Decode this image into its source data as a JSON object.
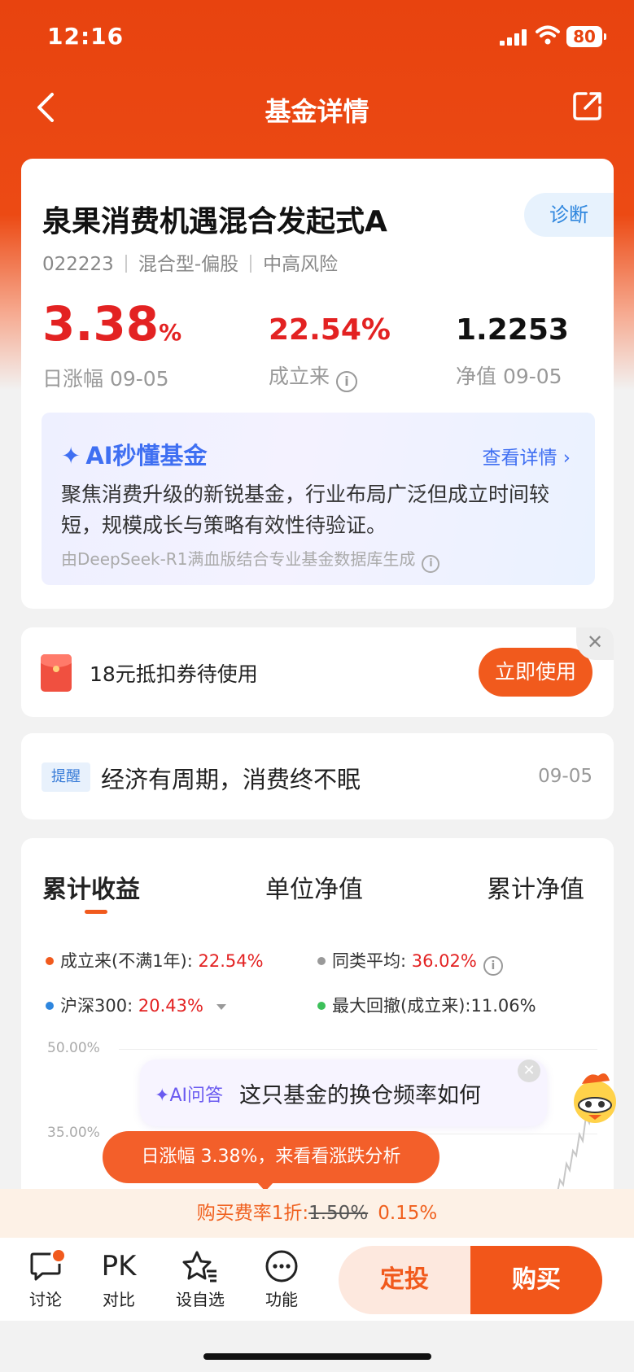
{
  "status": {
    "time": "12:16",
    "battery": "80"
  },
  "nav": {
    "title": "基金详情",
    "back_icon": "chevron-left-icon",
    "share_icon": "share-icon"
  },
  "fund": {
    "name": "泉果消费机遇混合发起式A",
    "diagnose_label": "诊断",
    "code": "022223",
    "type": "混合型-偏股",
    "risk": "中高风险",
    "daily_change": "3.38",
    "daily_change_unit": "%",
    "daily_change_label": "日涨幅 09-05",
    "since_inception": "22.54%",
    "since_inception_label": "成立来",
    "nav_value": "1.2253",
    "nav_label": "净值 09-05"
  },
  "ai_card": {
    "title": "AI秒懂基金",
    "more": "查看详情",
    "text": "聚焦消费升级的新锐基金，行业布局广泛但成立时间较短，规模成长与策略有效性待验证。",
    "source": "由DeepSeek-R1满血版结合专业基金数据库生成"
  },
  "coupon": {
    "text": "18元抵扣券待使用",
    "button": "立即使用"
  },
  "reminder": {
    "tag": "提醒",
    "text": "经济有周期，消费终不眠",
    "date": "09-05"
  },
  "chart": {
    "tabs": [
      "累计收益",
      "单位净值",
      "累计净值"
    ],
    "legend": [
      {
        "label": "成立来(不满1年):",
        "value": "22.54%",
        "color": "#f15a1d"
      },
      {
        "label": "同类平均:",
        "value": "36.02%",
        "color": "#999999"
      },
      {
        "label": "沪深300:",
        "value": "20.43%",
        "color": "#2e86de"
      },
      {
        "label": "最大回撤(成立来):",
        "value": "11.06%",
        "color": "#3cc05a"
      }
    ],
    "y_ticks": [
      "50.00%",
      "35.00%"
    ]
  },
  "ai_ask": {
    "label": "AI问答",
    "question": "这只基金的换仓频率如何"
  },
  "rise_bubble": "日涨幅 3.38%，来看看涨跌分析",
  "fee": {
    "label": "购买费率1折:",
    "old": "1.50%",
    "new": "0.15%"
  },
  "toolbar": {
    "items": [
      {
        "label": "讨论",
        "icon": "chat-bubble-icon"
      },
      {
        "label": "对比",
        "icon": "PK"
      },
      {
        "label": "设自选",
        "icon": "star-list-icon"
      },
      {
        "label": "功能",
        "icon": "more-dots-icon"
      }
    ],
    "plan": "定投",
    "buy": "购买"
  },
  "colors": {
    "brand": "#e8430f",
    "rise": "#e32222",
    "accent": "#f15a1d",
    "ai_blue": "#3f6ff2"
  }
}
